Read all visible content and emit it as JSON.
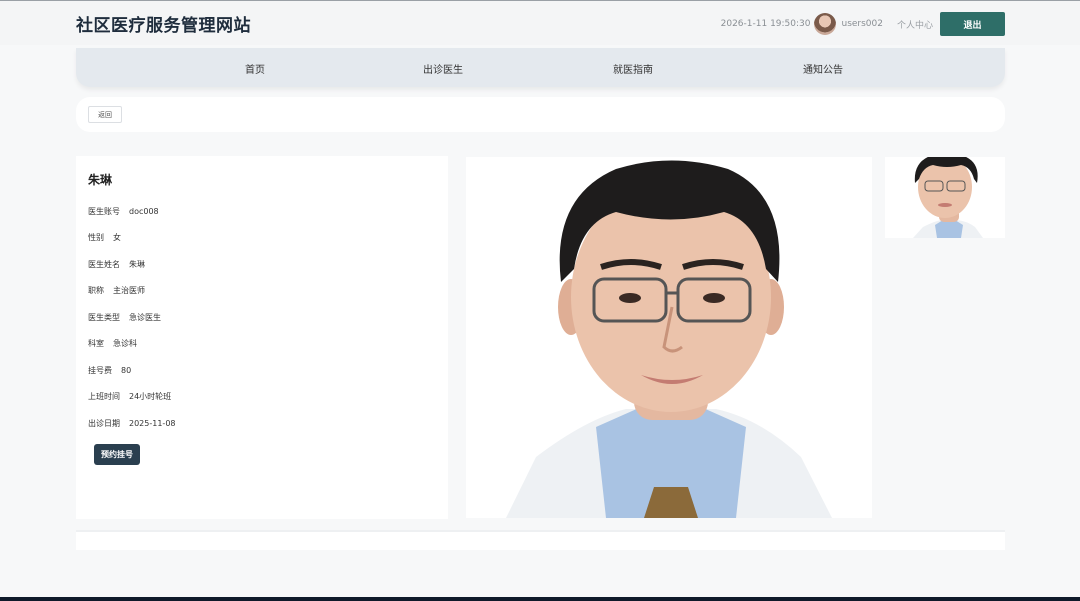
{
  "header": {
    "title": "社区医疗服务管理网站",
    "datetime": "2026-1-11 19:50:30",
    "username": "users002",
    "profile_link": "个人中心",
    "logout_label": "退出"
  },
  "nav": {
    "items": [
      {
        "label": "首页"
      },
      {
        "label": "出诊医生"
      },
      {
        "label": "就医指南"
      },
      {
        "label": "通知公告"
      }
    ]
  },
  "back_label": "返回",
  "doctor": {
    "name": "朱琳",
    "fields": [
      {
        "label": "医生账号",
        "value": "doc008"
      },
      {
        "label": "性别",
        "value": "女"
      },
      {
        "label": "医生姓名",
        "value": "朱琳"
      },
      {
        "label": "职称",
        "value": "主治医师"
      },
      {
        "label": "医生类型",
        "value": "急诊医生"
      },
      {
        "label": "科室",
        "value": "急诊科"
      },
      {
        "label": "挂号费",
        "value": "80"
      },
      {
        "label": "上班时间",
        "value": "24小时轮班"
      },
      {
        "label": "出诊日期",
        "value": "2025-11-08"
      }
    ],
    "book_label": "预约挂号"
  },
  "colors": {
    "accent": "#2e6e68",
    "book_button": "#2a3f4f",
    "nav_bg": "#e4e9ee"
  }
}
